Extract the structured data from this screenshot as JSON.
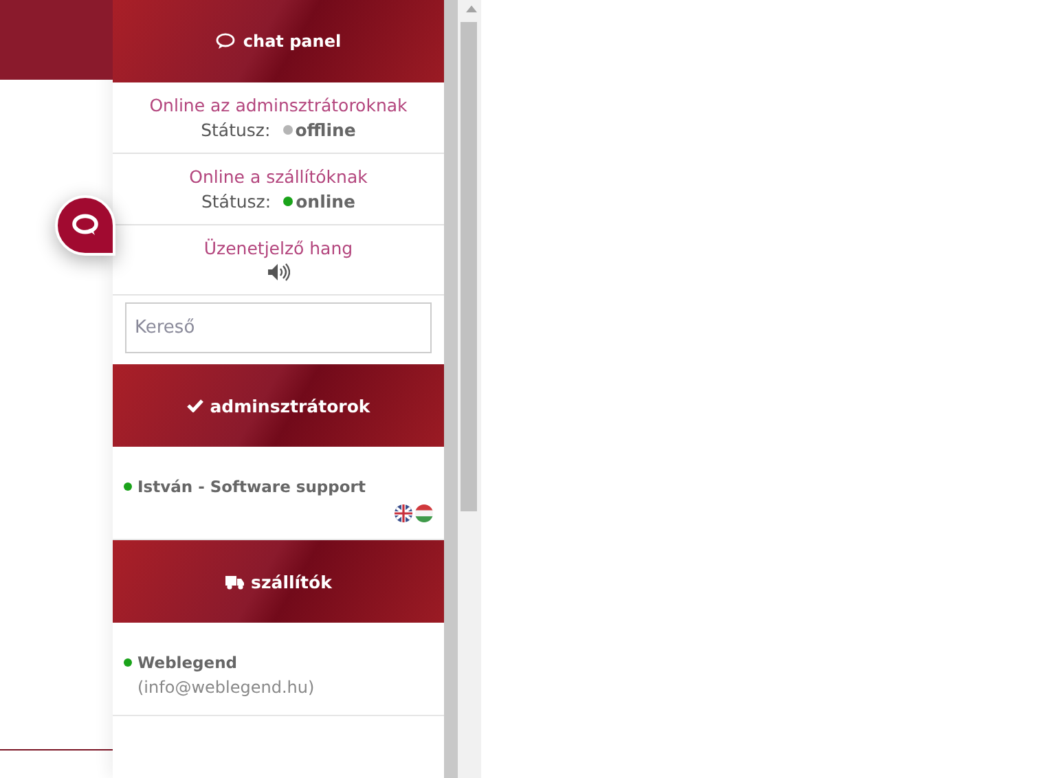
{
  "panel": {
    "title": "chat panel"
  },
  "settings": [
    {
      "kind": "status",
      "label": "Online az adminsztrátoroknak",
      "status_label": "Státusz:",
      "status": "offline",
      "online": false
    },
    {
      "kind": "status",
      "label": "Online a szállítóknak",
      "status_label": "Státusz:",
      "status": "online",
      "online": true
    },
    {
      "kind": "sound",
      "label": "Üzenetjelző hang"
    }
  ],
  "search": {
    "placeholder": "Kereső"
  },
  "groups": [
    {
      "kind": "check",
      "title": "adminsztrátorok",
      "contacts": [
        {
          "name": "István - Software support",
          "online": true,
          "flags": true
        }
      ]
    },
    {
      "kind": "truck",
      "title": "szállítók",
      "contacts": [
        {
          "name": "Weblegend",
          "email": "(info@weblegend.hu)",
          "online": true,
          "flags": false
        }
      ]
    }
  ]
}
